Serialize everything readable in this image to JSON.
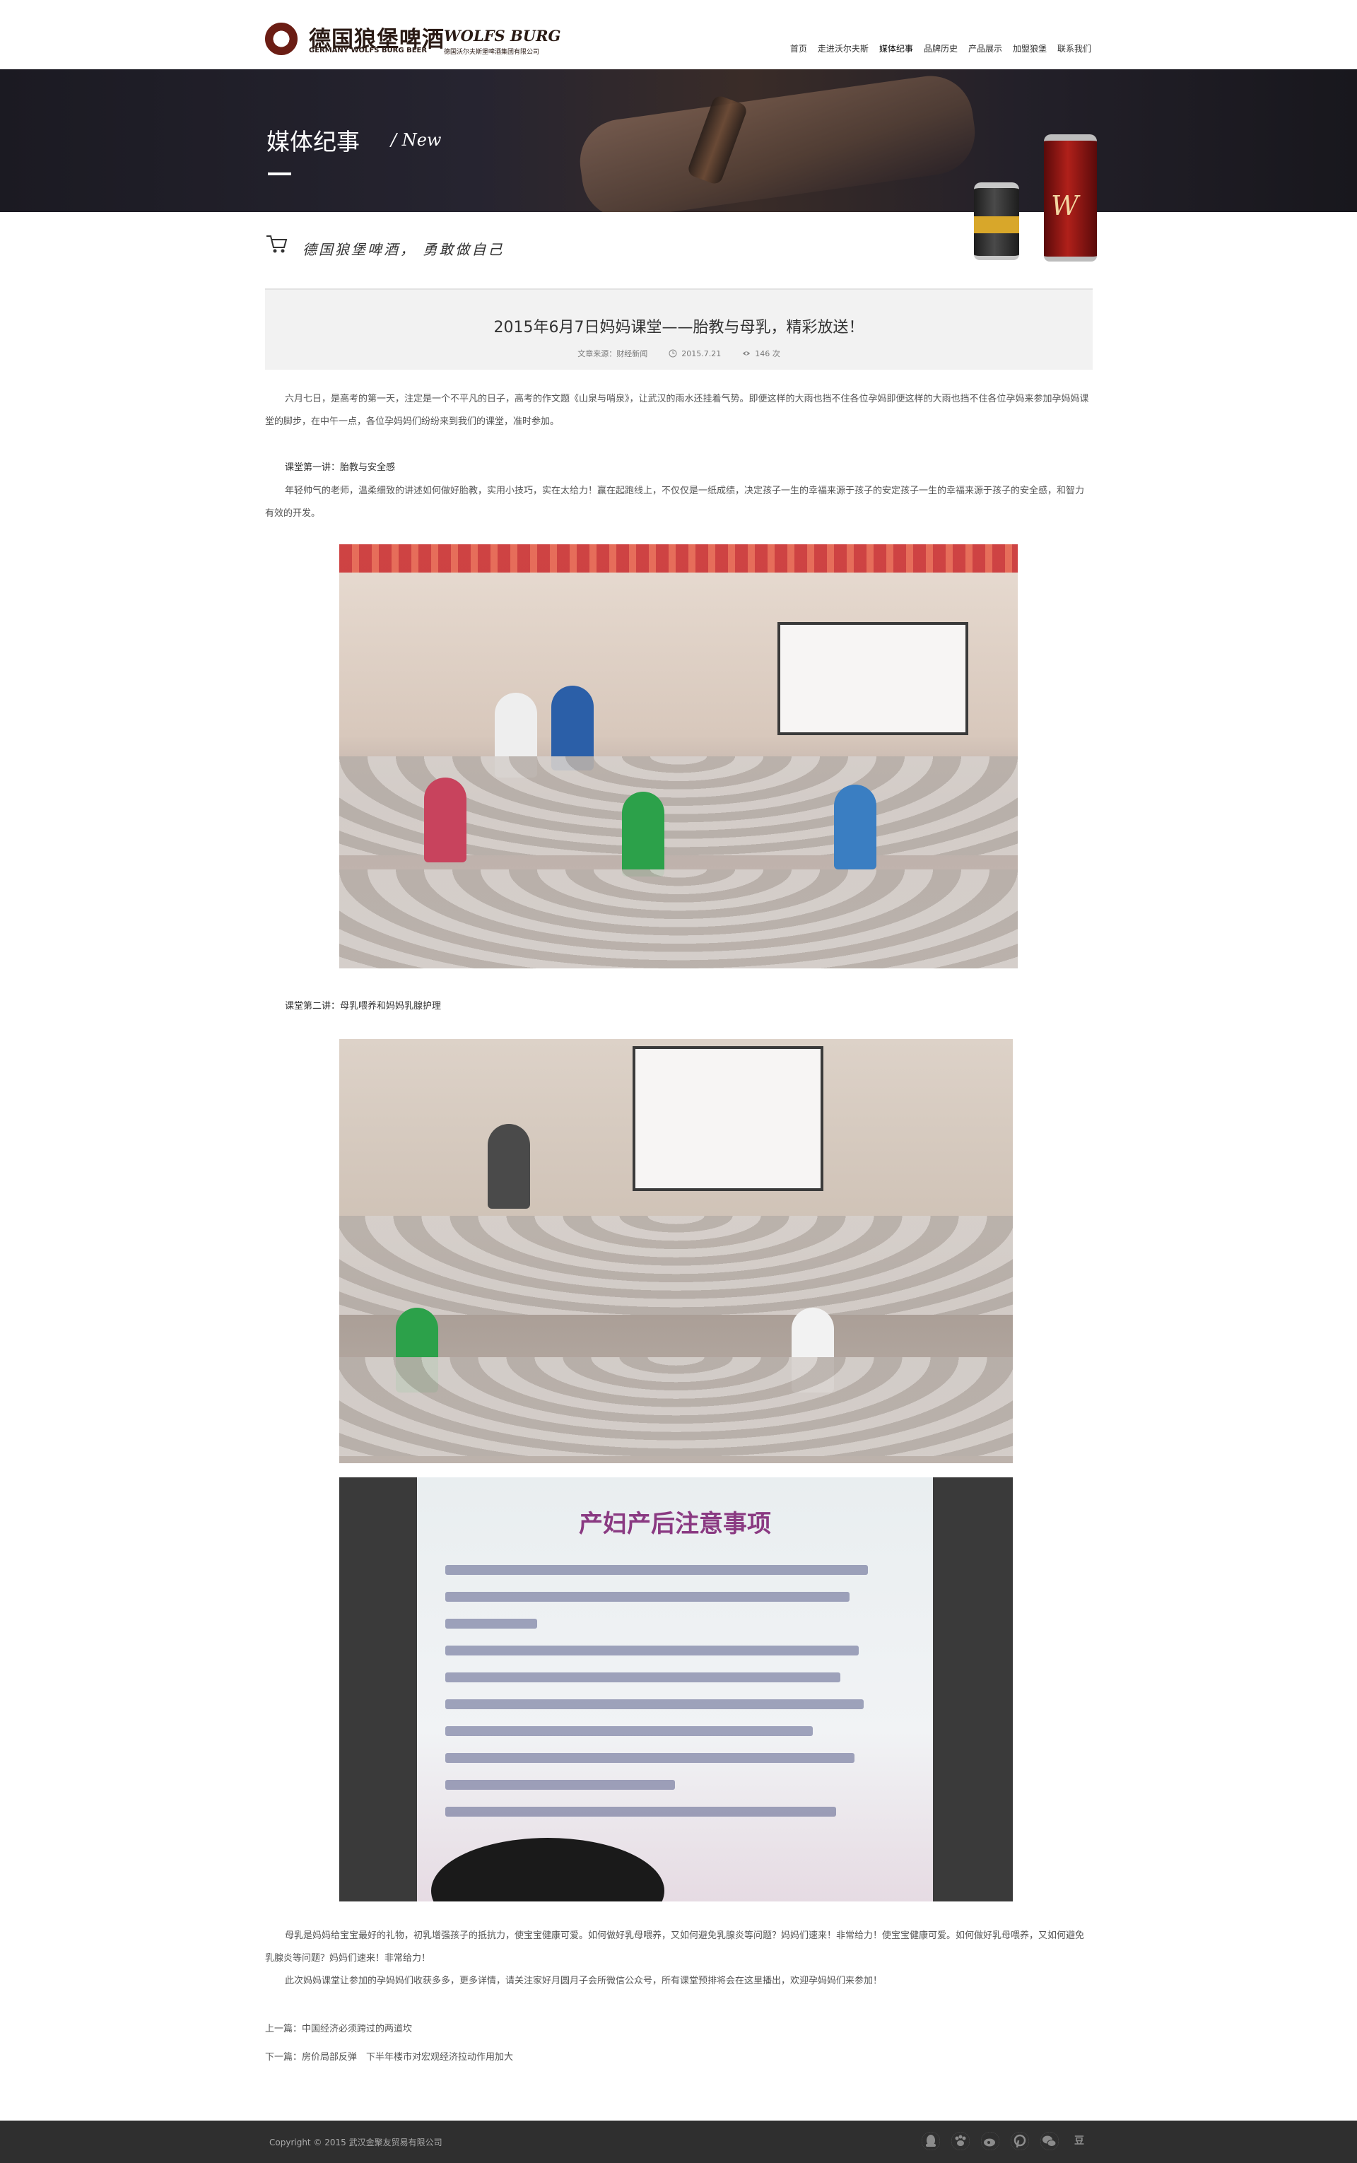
{
  "brand": {
    "name_cn": "德国狼堡啤酒",
    "name_latin": "WOLFS BURG",
    "tagline_en": "GERMANY WOLFS BURG BEER",
    "company_cn": "德国沃尔夫斯堡啤酒集团有限公司"
  },
  "nav": {
    "items": [
      "首页",
      "走进沃尔夫斯",
      "媒体纪事",
      "品牌历史",
      "产品展示",
      "加盟狼堡",
      "联系我们"
    ],
    "active_index": 2
  },
  "banner": {
    "title": "媒体纪事",
    "subtitle": "/ New"
  },
  "slogan": "德国狼堡啤酒， 勇敢做自己",
  "article": {
    "title": "2015年6月7日妈妈课堂——胎教与母乳，精彩放送！",
    "source_label": "文章来源：财经新闻",
    "date": "2015.7.21",
    "views": "146 次",
    "para1": "六月七日，是高考的第一天，注定是一个不平凡的日子，高考的作文题《山泉与哨泉》，让武汉的雨水还挂着气势。即便这样的大雨也挡不住各位孕妈即便这样的大雨也挡不住各位孕妈来参加孕妈妈课堂的脚步，在中午一点，各位孕妈妈们纷纷来到我们的课堂，准时参加。",
    "lesson1_title": "课堂第一讲：胎教与安全感",
    "lesson1_body": "年轻帅气的老师，温柔细致的讲述如何做好胎教，实用小技巧，实在太给力！赢在起跑线上，不仅仅是一纸成绩，决定孩子一生的幸福来源于孩子的安定孩子一生的幸福来源于孩子的安全感，和智力有效的开发。",
    "lesson2_title": "课堂第二讲：母乳喂养和妈妈乳腺护理",
    "slide_title": "产妇产后注意事项",
    "para_end1": "母乳是妈妈给宝宝最好的礼物，初乳增强孩子的抵抗力，使宝宝健康可爱。如何做好乳母喂养，又如何避免乳腺炎等问题？妈妈们速来！非常给力！使宝宝健康可爱。如何做好乳母喂养，又如何避免乳腺炎等问题？妈妈们速来！非常给力！",
    "para_end2": "此次妈妈课堂让参加的孕妈妈们收获多多，更多详情，请关注家好月圆月子会所微信公众号，所有课堂预排将会在这里播出，欢迎孕妈妈们来参加！"
  },
  "pager": {
    "prev_label": "上一篇：",
    "prev_title": "中国经济必须跨过的两道坎",
    "next_label": "下一篇：",
    "next_title": "房价局部反弹　下半年楼市对宏观经济拉动作用加大"
  },
  "footer": {
    "copyright": "Copyright © 2015  武汉金聚友贸易有限公司",
    "social_icons": [
      "qq-icon",
      "paw-icon",
      "weibo-icon",
      "pinterest-icon",
      "wechat-icon",
      "douban-icon"
    ],
    "douban_glyph": "豆"
  },
  "colors": {
    "brand_dark": "#2a1a14",
    "footer_bg": "#2f2f2f",
    "article_head_bg": "#f2f2f2"
  }
}
